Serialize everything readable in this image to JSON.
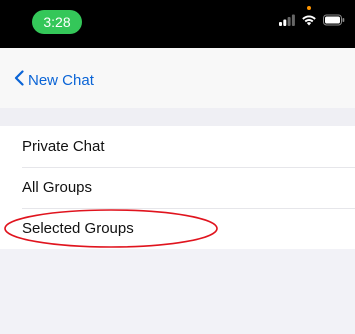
{
  "status_bar": {
    "time": "3:28",
    "icons": [
      "signal-icon",
      "wifi-icon",
      "battery-icon"
    ]
  },
  "nav": {
    "back_label": "New Chat",
    "back_icon": "chevron-left-icon"
  },
  "list": {
    "items": [
      {
        "label": "Private Chat"
      },
      {
        "label": "All Groups"
      },
      {
        "label": "Selected Groups"
      }
    ]
  },
  "colors": {
    "accent": "#0a64d6",
    "time_pill": "#34c759",
    "annotation": "#e0141e",
    "background": "#f2f2f7"
  }
}
